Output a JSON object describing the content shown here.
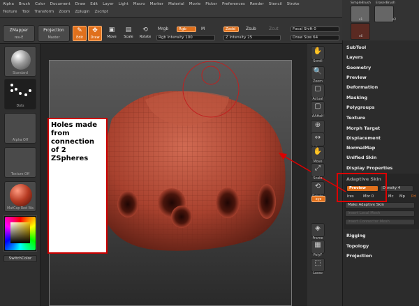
{
  "menu": {
    "row1": [
      "Alpha",
      "Brush",
      "Color",
      "Document",
      "Draw",
      "Edit",
      "Layer",
      "Light",
      "Macro",
      "Marker",
      "Material",
      "Movie",
      "Picker",
      "Preferences",
      "Render",
      "Stencil",
      "Stroke"
    ],
    "row2": [
      "Texture",
      "Tool",
      "Transform",
      "Zoom",
      "Zplugin",
      "Zscript"
    ]
  },
  "shelf": {
    "zmapper": "ZMapper",
    "zmapper_sub": "rev-E",
    "projection": "Projection",
    "projection_sub": "Master",
    "edit": "Edit",
    "draw": "Draw",
    "move": "Move",
    "scale": "Scale",
    "rotate": "Rotate",
    "mrgb": "Mrgb",
    "rgb": "Rgb",
    "m": "M",
    "rgb_intensity": "Rgb Intensity 100",
    "zadd": "Zadd",
    "zsub": "Zsub",
    "zcut": "Zcut",
    "z_intensity": "Z Intensity 25",
    "focal_shift": "Focal Shift 0",
    "draw_size": "Draw Size 64"
  },
  "left": {
    "standard": "Standard",
    "dots": "Dots",
    "alpha": "Alpha Off",
    "texture": "Texture Off",
    "matcap": "MatCap Red Wa",
    "switchcolor": "SwitchColor"
  },
  "rightstrip": [
    "Scroll",
    "Zoom",
    "Actual",
    "AAHalf",
    "Local",
    "L.Sym",
    "Move",
    "Scale",
    "Rotate",
    "xyz",
    "Frame",
    "PolyF",
    "Lasso"
  ],
  "subtool": {
    "items": [
      "SimpleBrush",
      "EraserBrush",
      "s1",
      "s2",
      "s6"
    ]
  },
  "panel": {
    "items": [
      "SubTool",
      "Layers",
      "Geometry",
      "Preview",
      "Deformation",
      "Masking",
      "Polygroups",
      "Texture",
      "Morph Target",
      "Displacement",
      "NormalMap",
      "Unified Skin",
      "Display Properties"
    ],
    "adaptive_skin": "Adaptive Skin",
    "preview_btn": "Preview",
    "density": "Density 4",
    "ires": "Ires",
    "mbr": "Mbr 0",
    "mc": "Mc",
    "mp": "Mp",
    "pd": "Pd",
    "make_adaptive": "Make Adaptive Skin",
    "insert_local": "Insert Local Mesh",
    "insert_connector": "Insert Connector Mesh",
    "bottom": [
      "Rigging",
      "Topology",
      "Projection"
    ]
  },
  "annotation": "Holes made from connection of 2 ZSpheres",
  "colors": {
    "accent": "#e0701c",
    "annotation_border": "#cc0000",
    "mesh": "#a8412e"
  }
}
